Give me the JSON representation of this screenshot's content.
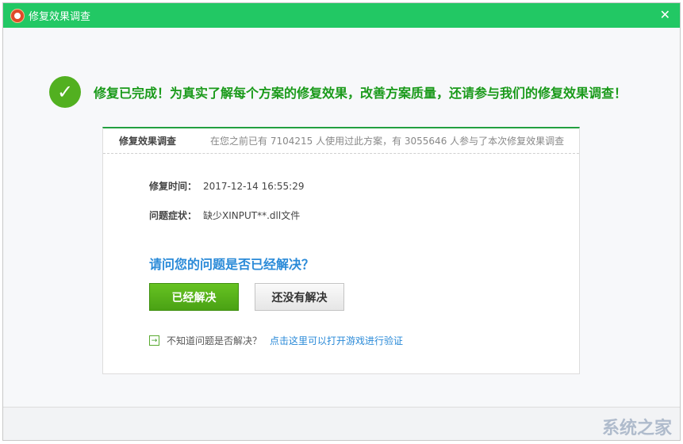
{
  "window": {
    "title": "修复效果调查",
    "close_icon": "close-icon"
  },
  "headline": "修复已完成！为真实了解每个方案的修复效果，改善方案质量，还请参与我们的修复效果调查！",
  "card": {
    "title": "修复效果调查",
    "stats": "在您之前已有 7104215 人使用过此方案，有 3055646 人参与了本次修复效果调查",
    "time_label": "修复时间：",
    "time_value": "2017-12-14 16:55:29",
    "symptom_label": "问题症状：",
    "symptom_value": "缺少XINPUT**.dll文件",
    "question": "请问您的问题是否已经解决？",
    "yes_button": "已经解决",
    "no_button": "还没有解决",
    "hint": "不知道问题是否解决？",
    "hint_link": "点击这里可以打开游戏进行验证"
  },
  "watermark": "系统之家",
  "colors": {
    "titlebar": "#22c864",
    "accent_green": "#52b020",
    "link_blue": "#2a8ad8"
  }
}
